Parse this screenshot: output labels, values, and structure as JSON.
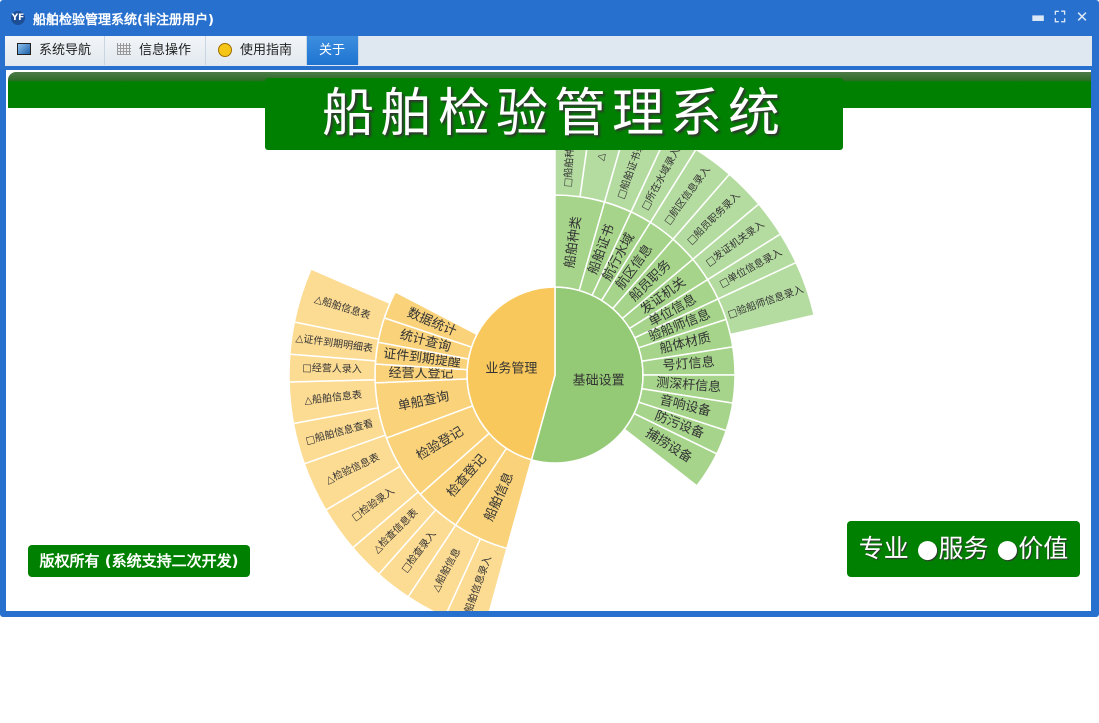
{
  "window": {
    "title": "船舶检验管理系统(非注册用户)",
    "app_icon": "YF"
  },
  "tabs": [
    {
      "label": "系统导航",
      "icon": "monitor-icon"
    },
    {
      "label": "信息操作",
      "icon": "grid-icon"
    },
    {
      "label": "使用指南",
      "icon": "help-icon"
    },
    {
      "label": "关于",
      "active": true
    }
  ],
  "banner": {
    "title": "船舶检验管理系统"
  },
  "footer": {
    "copyright": "版权所有 (系统支持二次开发)",
    "slogan": "专业 ●服务 ●价值"
  },
  "colors": {
    "green": "#008000",
    "frame": "#2770cd"
  },
  "chart_data": {
    "type": "sunburst",
    "unit": "degrees of arc",
    "rings": [
      [
        {
          "label": "基础设置",
          "span": 195.5,
          "group": "g"
        },
        {
          "label": "业务管理",
          "span": 164.5,
          "group": "o"
        }
      ],
      [
        {
          "label": "船舶种类",
          "span": 16,
          "group": "g"
        },
        {
          "label": "船舶证书",
          "span": 9,
          "group": "g"
        },
        {
          "label": "航行水域",
          "span": 7,
          "group": "g"
        },
        {
          "label": "航区信息",
          "span": 9,
          "group": "g"
        },
        {
          "label": "船员职务",
          "span": 9,
          "group": "g"
        },
        {
          "label": "发证机关",
          "span": 8,
          "group": "g"
        },
        {
          "label": "单位信息",
          "span": 7,
          "group": "g"
        },
        {
          "label": "验船师信息",
          "span": 7,
          "group": "g"
        },
        {
          "label": "船体材质",
          "span": 9,
          "group": "g"
        },
        {
          "label": "号灯信息",
          "span": 9,
          "group": "g"
        },
        {
          "label": "测深杆信息",
          "span": 9,
          "group": "g"
        },
        {
          "label": "音响设备",
          "span": 9,
          "group": "g"
        },
        {
          "label": "防污设备",
          "span": 8,
          "group": "g"
        },
        {
          "label": "捕捞设备",
          "span": 12,
          "group": "g"
        },
        {
          "gap": 67.5
        },
        {
          "label": "船舶信息",
          "span": 18,
          "group": "o"
        },
        {
          "label": "检查登记",
          "span": 15,
          "group": "o"
        },
        {
          "label": "检验登记",
          "span": 21,
          "group": "o"
        },
        {
          "label": "单船查询",
          "span": 18,
          "group": "o"
        },
        {
          "label": "经营人登记",
          "span": 6,
          "group": "o"
        },
        {
          "label": "证件到期提醒",
          "span": 7,
          "group": "o"
        },
        {
          "label": "统计查询",
          "span": 8,
          "group": "o"
        },
        {
          "label": "数据统计",
          "span": 9,
          "group": "o"
        }
      ],
      [
        {
          "label": "□船舶种类录入",
          "span": 8,
          "group": "g"
        },
        {
          "label": "△",
          "span": 8,
          "group": "g"
        },
        {
          "label": "□船舶证书录入",
          "span": 9,
          "group": "g"
        },
        {
          "label": "□所在水域录入",
          "span": 7,
          "group": "g"
        },
        {
          "label": "□航区信息录入",
          "span": 9,
          "group": "g"
        },
        {
          "label": "□船员职务录入",
          "span": 9,
          "group": "g"
        },
        {
          "label": "□发证机关录入",
          "span": 8,
          "group": "g"
        },
        {
          "label": "□单位信息录入",
          "span": 7,
          "group": "g"
        },
        {
          "label": "□验船师信息录入",
          "span": 12,
          "group": "g"
        },
        {
          "gap": 118.5
        },
        {
          "label": "船舶信息录入",
          "span": 9,
          "group": "o"
        },
        {
          "label": "△船舶信息",
          "span": 9,
          "group": "o"
        },
        {
          "label": "□检查录入",
          "span": 8,
          "group": "o"
        },
        {
          "label": "△检查信息表",
          "span": 8,
          "group": "o"
        },
        {
          "label": "□检验录入",
          "span": 10,
          "group": "o"
        },
        {
          "label": "△检验信息表",
          "span": 11,
          "group": "o"
        },
        {
          "label": "□船舶信息查看",
          "span": 9,
          "group": "o"
        },
        {
          "label": "△船舶信息表",
          "span": 9,
          "group": "o"
        },
        {
          "label": "□经营人录入",
          "span": 6,
          "group": "o"
        },
        {
          "label": "△证件到期明细表",
          "span": 7,
          "group": "o"
        },
        {
          "label": "△船舶信息表",
          "span": 12,
          "group": "o"
        }
      ]
    ]
  }
}
